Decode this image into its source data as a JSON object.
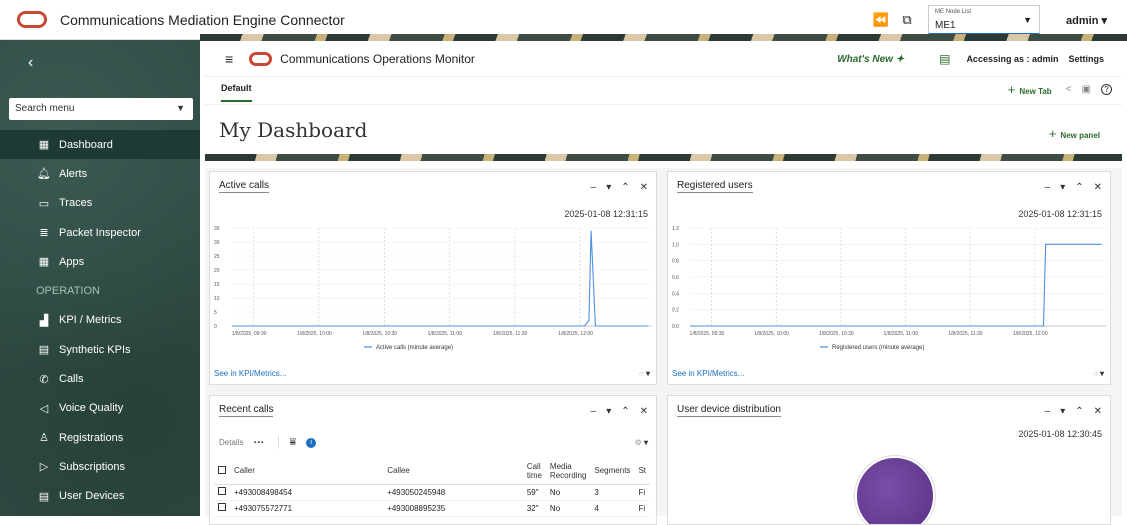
{
  "app": {
    "title": "Communications Mediation Engine Connector"
  },
  "topbar": {
    "node_label": "ME Node List",
    "node_value": "ME1",
    "user": "admin"
  },
  "sidebar": {
    "search_placeholder": "Search menu",
    "items": [
      {
        "label": "Dashboard",
        "icon": "dashboard-icon",
        "glyph": "▦"
      },
      {
        "label": "Alerts",
        "icon": "bell-icon",
        "glyph": "♫"
      },
      {
        "label": "Traces",
        "icon": "traces-icon",
        "glyph": "▭"
      },
      {
        "label": "Packet Inspector",
        "icon": "packet-icon",
        "glyph": "≣"
      },
      {
        "label": "Apps",
        "icon": "apps-icon",
        "glyph": "▦"
      },
      {
        "label": "OPERATION",
        "icon": "",
        "glyph": ""
      },
      {
        "label": "KPI / Metrics",
        "icon": "chart-icon",
        "glyph": "▟"
      },
      {
        "label": "Synthetic KPIs",
        "icon": "grid-icon",
        "glyph": "▤"
      },
      {
        "label": "Calls",
        "icon": "phone-icon",
        "glyph": "✆"
      },
      {
        "label": "Voice Quality",
        "icon": "speaker-icon",
        "glyph": "◁"
      },
      {
        "label": "Registrations",
        "icon": "person-icon",
        "glyph": "♙"
      },
      {
        "label": "Subscriptions",
        "icon": "play-icon",
        "glyph": "▷"
      },
      {
        "label": "User Devices",
        "icon": "device-icon",
        "glyph": "▤"
      }
    ]
  },
  "header": {
    "title": "Communications Operations Monitor",
    "whats_new": "What's New",
    "accessing": "Accessing as : admin",
    "settings": "Settings"
  },
  "tabs": {
    "default": "Default",
    "new_tab": "New Tab"
  },
  "dashboard": {
    "title": "My Dashboard",
    "new_panel": "New panel"
  },
  "panels": {
    "active_calls": {
      "title": "Active calls",
      "timestamp": "2025-01-08 12:31:15",
      "link": "See in KPI/Metrics...",
      "legend": "Active calls (minute average)"
    },
    "registered_users": {
      "title": "Registered users",
      "timestamp": "2025-01-08 12:31:15",
      "link": "See in KPI/Metrics...",
      "legend": "Registered users (minute average)"
    },
    "recent_calls": {
      "title": "Recent calls",
      "details": "Details",
      "columns": [
        "Caller",
        "Callee",
        "Call time",
        "Media Recording",
        "Segments",
        "St"
      ],
      "rows": [
        [
          "+493008498454",
          "+493050245948",
          "59\"",
          "No",
          "3",
          "Fi"
        ],
        [
          "+493075572771",
          "+493008895235",
          "32\"",
          "No",
          "4",
          "Fi"
        ]
      ]
    },
    "user_devices": {
      "title": "User device distribution",
      "timestamp": "2025-01-08 12:30:45"
    }
  },
  "chart_data": [
    {
      "type": "line",
      "title": "Active calls",
      "x_ticks": [
        "1/8/2025, 09:30",
        "1/8/2025, 10:00",
        "1/8/2025, 10:30",
        "1/8/2025, 11:00",
        "1/8/2025, 11:30",
        "1/8/2025, 12:00"
      ],
      "y_ticks": [
        0,
        5,
        10,
        15,
        20,
        25,
        30,
        35
      ],
      "ylim": [
        0,
        35
      ],
      "series": [
        {
          "name": "Active calls (minute average)",
          "x": [
            "09:20",
            "12:02",
            "12:04",
            "12:05",
            "12:07",
            "12:31"
          ],
          "values": [
            0,
            0,
            2,
            34,
            0,
            0
          ]
        }
      ],
      "color": "#4a90e2"
    },
    {
      "type": "line",
      "title": "Registered users",
      "x_ticks": [
        "1/8/2025, 09:30",
        "1/8/2025, 10:00",
        "1/8/2025, 10:30",
        "1/8/2025, 11:00",
        "1/8/2025, 11:30",
        "1/8/2025, 12:00"
      ],
      "y_ticks": [
        0.0,
        0.2,
        0.4,
        0.6,
        0.8,
        1.0,
        1.2
      ],
      "ylim": [
        0,
        1.2
      ],
      "series": [
        {
          "name": "Registered users (minute average)",
          "x": [
            "09:20",
            "12:04",
            "12:05",
            "12:31"
          ],
          "values": [
            0,
            0,
            1,
            1
          ]
        }
      ],
      "color": "#4a90e2"
    }
  ]
}
